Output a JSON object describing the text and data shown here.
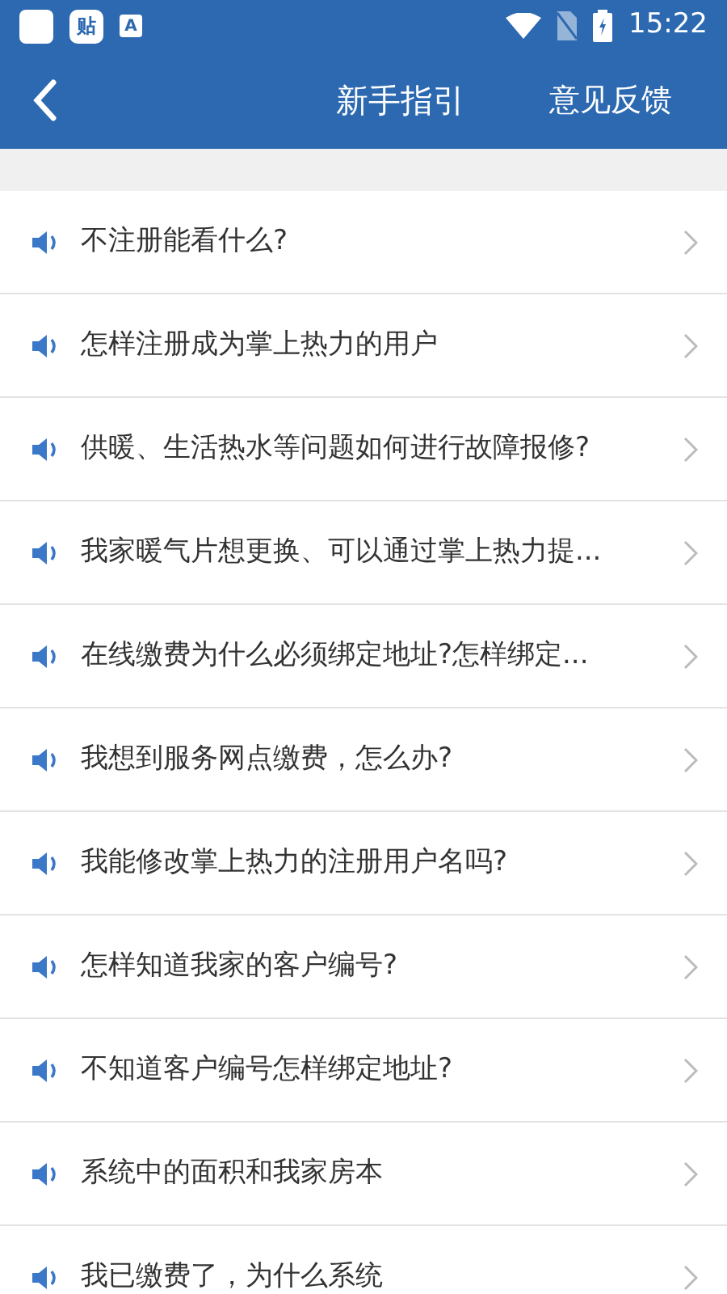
{
  "status_bar": {
    "time": "15:22",
    "notification_icons": [
      "贴",
      "A"
    ]
  },
  "header": {
    "title": "新手指引",
    "action": "意见反馈"
  },
  "questions": [
    {
      "text": "不注册能看什么?"
    },
    {
      "text": "怎样注册成为掌上热力的用户"
    },
    {
      "text": "供暖、生活热水等问题如何进行故障报修?"
    },
    {
      "text": "我家暖气片想更换、可以通过掌上热力提..."
    },
    {
      "text": "在线缴费为什么必须绑定地址?怎样绑定..."
    },
    {
      "text": "我想到服务网点缴费，怎么办?"
    },
    {
      "text": "我能修改掌上热力的注册用户名吗?"
    },
    {
      "text": "怎样知道我家的客户编号?"
    },
    {
      "text": "不知道客户编号怎样绑定地址?"
    },
    {
      "text": "系统中的面积和我家房本"
    },
    {
      "text": "我已缴费了，为什么系统"
    }
  ]
}
